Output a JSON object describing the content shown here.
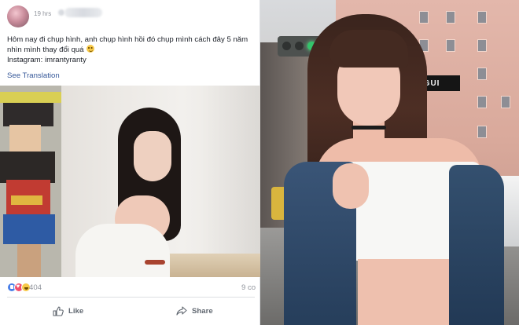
{
  "post": {
    "timestamp": "19 hrs",
    "caption_lines": [
      "Hôm nay đi chụp hình, anh chụp hình hồi đó chụp mình cách đây 5 năm",
      "nhìn mình thay đổi quá",
      "Instagram: imrantyranty"
    ],
    "see_translation": "See Translation",
    "reaction_count": "404",
    "comment_count": "9 co",
    "actions": {
      "like": "Like",
      "share": "Share"
    },
    "reaction_icons": [
      "like-icon",
      "love-icon",
      "haha-icon"
    ],
    "colors": {
      "link": "#365899",
      "meta_text": "#90949c",
      "divider": "#dddfe2"
    }
  },
  "street_photo": {
    "sign_text": "EGUI"
  }
}
